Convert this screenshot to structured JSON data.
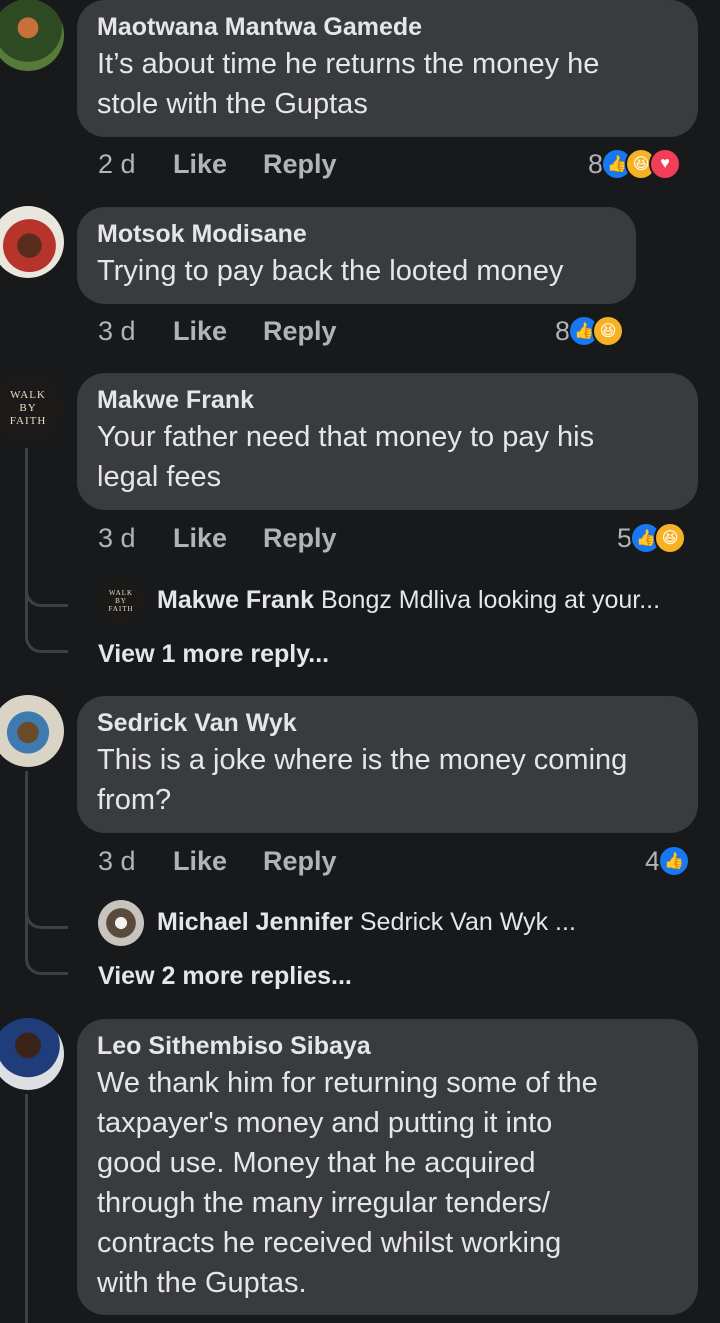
{
  "comments": [
    {
      "name": "Maotwana Mantwa Gamede",
      "lines": [
        "It’s about time he returns the money he",
        "stole with the Guptas"
      ],
      "time": "2 d",
      "like": "Like",
      "reply": "Reply",
      "reactions": "8"
    },
    {
      "name": "Motsok Modisane",
      "lines": [
        "Trying to pay back the looted money"
      ],
      "time": "3 d",
      "like": "Like",
      "reply": "Reply",
      "reactions": "8"
    },
    {
      "name": "Makwe Frank",
      "avatar_text": [
        "WALK",
        "BY",
        "FAITH"
      ],
      "lines": [
        "Your father need that money to pay his",
        "legal fees"
      ],
      "time": "3 d",
      "like": "Like",
      "reply": "Reply",
      "reactions": "5",
      "reply_preview": {
        "name": "Makwe Frank",
        "text": "Bongz Mdliva looking at your..."
      },
      "view_more": "View 1 more reply..."
    },
    {
      "name": "Sedrick Van Wyk",
      "lines": [
        "This is a joke where is the money coming",
        "from?"
      ],
      "time": "3 d",
      "like": "Like",
      "reply": "Reply",
      "reactions": "4",
      "reply_preview": {
        "name": "Michael Jennifer",
        "text": "Sedrick Van Wyk ..."
      },
      "view_more": "View 2 more replies..."
    },
    {
      "name": "Leo Sithembiso Sibaya",
      "lines": [
        "We thank him for returning some of the",
        "taxpayer's money and putting it into",
        "good use. Money that he acquired",
        "through the many irregular tenders/",
        "contracts he received whilst working",
        "with the Guptas."
      ]
    }
  ],
  "colors": {
    "background": "#18191a",
    "bubble": "#3a3b3c",
    "like": "#1877f2",
    "haha": "#f7b125",
    "love": "#f33e58"
  }
}
